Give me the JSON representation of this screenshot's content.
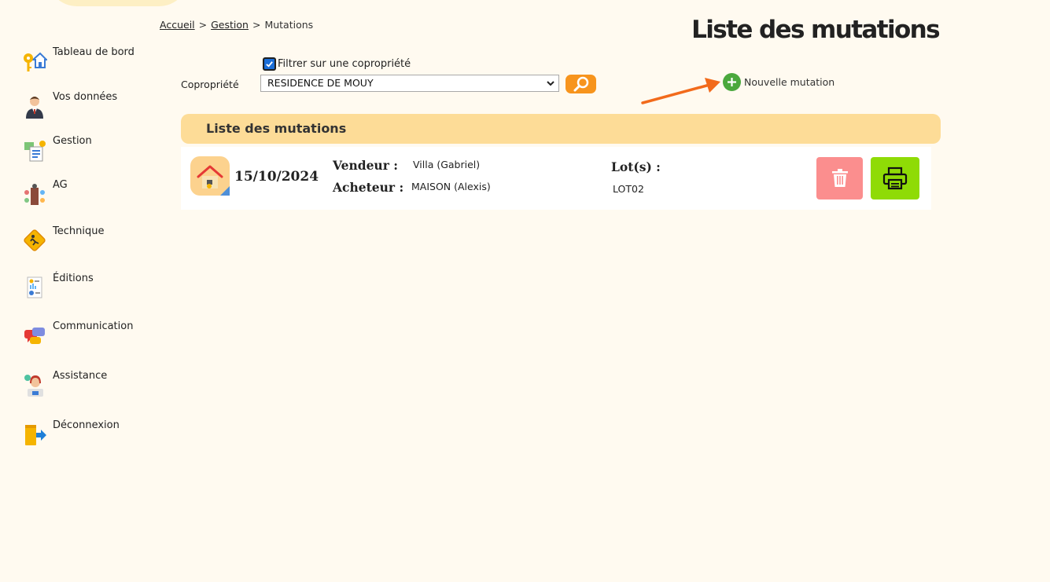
{
  "breadcrumb": {
    "home": "Accueil",
    "gestion": "Gestion",
    "current": "Mutations",
    "separator": ">"
  },
  "page_title": "Liste des mutations",
  "sidebar": {
    "items": [
      {
        "label": "Tableau de bord",
        "icon": "dashboard-house-key-icon"
      },
      {
        "label": "Vos données",
        "icon": "user-avatar-icon"
      },
      {
        "label": "Gestion",
        "icon": "management-icon"
      },
      {
        "label": "AG",
        "icon": "meeting-icon"
      },
      {
        "label": "Technique",
        "icon": "technique-warning-icon"
      },
      {
        "label": "Éditions",
        "icon": "document-report-icon"
      },
      {
        "label": "Communication",
        "icon": "chat-bubbles-icon"
      },
      {
        "label": "Assistance",
        "icon": "support-agent-icon"
      },
      {
        "label": "Déconnexion",
        "icon": "logout-door-icon"
      }
    ]
  },
  "filter": {
    "checkbox_label": "Filtrer sur une copropriété",
    "checked": true,
    "copro_label": "Copropriété",
    "copro_value": "RESIDENCE DE MOUY"
  },
  "new_mutation_label": "Nouvelle mutation",
  "list": {
    "title": "Liste des mutations",
    "rows": [
      {
        "date": "15/10/2024",
        "vendeur_label": "Vendeur :",
        "vendeur": "Villa (Gabriel)",
        "acheteur_label": "Acheteur :",
        "acheteur": "MAISON (Alexis)",
        "lots_label": "Lot(s) :",
        "lots": "LOT02"
      }
    ]
  },
  "colors": {
    "background": "#fffaf0",
    "header_band": "#fddc97",
    "search_button": "#f7941d",
    "delete_button": "#fb8e8e",
    "print_button": "#8fdb06",
    "add_icon": "#4aa83d",
    "arrow": "#f26a1b"
  }
}
